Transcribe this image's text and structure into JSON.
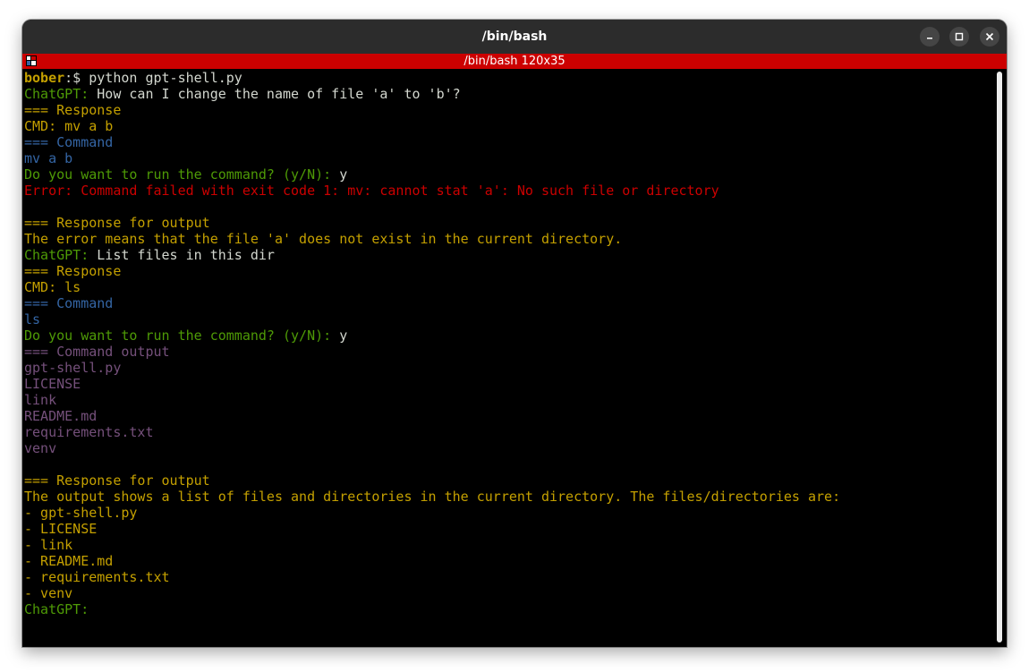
{
  "window": {
    "title": "/bin/bash",
    "tab_title": "/bin/bash 120x35",
    "controls": [
      "minimize-icon",
      "maximize-icon",
      "close-icon"
    ]
  },
  "colors": {
    "titlebar": "#2c2c2c",
    "tabbar": "#cc0000",
    "background": "#000000",
    "green": "#4e9a06",
    "yellow": "#c4a000",
    "blue": "#3465a4",
    "red": "#cc0000",
    "purple": "#75507b",
    "white": "#d3d7cf"
  },
  "terminal": {
    "lines": [
      [
        {
          "t": "bober",
          "c": "boldyellow"
        },
        {
          "t": ":$ python gpt-shell.py",
          "c": "white"
        }
      ],
      [
        {
          "t": "ChatGPT:",
          "c": "green"
        },
        {
          "t": " How can I change the name of file 'a' to 'b'?",
          "c": "white"
        }
      ],
      [
        {
          "t": "=== Response",
          "c": "yellow"
        }
      ],
      [
        {
          "t": "CMD: mv a b",
          "c": "yellow"
        }
      ],
      [
        {
          "t": "=== Command",
          "c": "blue"
        }
      ],
      [
        {
          "t": "mv a b",
          "c": "blue"
        }
      ],
      [
        {
          "t": "Do you want to run the command? (y/N):",
          "c": "green"
        },
        {
          "t": " y",
          "c": "white"
        }
      ],
      [
        {
          "t": "Error: Command failed with exit code 1: mv: cannot stat 'a': No such file or directory",
          "c": "red"
        }
      ],
      [],
      [
        {
          "t": "=== Response for output",
          "c": "yellow"
        }
      ],
      [
        {
          "t": "The error means that the file 'a' does not exist in the current directory.",
          "c": "yellow"
        }
      ],
      [
        {
          "t": "ChatGPT:",
          "c": "green"
        },
        {
          "t": " List files in this dir",
          "c": "white"
        }
      ],
      [
        {
          "t": "=== Response",
          "c": "yellow"
        }
      ],
      [
        {
          "t": "CMD: ls",
          "c": "yellow"
        }
      ],
      [
        {
          "t": "=== Command",
          "c": "blue"
        }
      ],
      [
        {
          "t": "ls",
          "c": "blue"
        }
      ],
      [
        {
          "t": "Do you want to run the command? (y/N):",
          "c": "green"
        },
        {
          "t": " y",
          "c": "white"
        }
      ],
      [
        {
          "t": "=== Command output",
          "c": "purple"
        }
      ],
      [
        {
          "t": "gpt-shell.py",
          "c": "purple"
        }
      ],
      [
        {
          "t": "LICENSE",
          "c": "purple"
        }
      ],
      [
        {
          "t": "link",
          "c": "purple"
        }
      ],
      [
        {
          "t": "README.md",
          "c": "purple"
        }
      ],
      [
        {
          "t": "requirements.txt",
          "c": "purple"
        }
      ],
      [
        {
          "t": "venv",
          "c": "purple"
        }
      ],
      [],
      [
        {
          "t": "=== Response for output",
          "c": "yellow"
        }
      ],
      [
        {
          "t": "The output shows a list of files and directories in the current directory. The files/directories are:",
          "c": "yellow"
        }
      ],
      [
        {
          "t": "- gpt-shell.py",
          "c": "yellow"
        }
      ],
      [
        {
          "t": "- LICENSE",
          "c": "yellow"
        }
      ],
      [
        {
          "t": "- link",
          "c": "yellow"
        }
      ],
      [
        {
          "t": "- README.md",
          "c": "yellow"
        }
      ],
      [
        {
          "t": "- requirements.txt",
          "c": "yellow"
        }
      ],
      [
        {
          "t": "- venv",
          "c": "yellow"
        }
      ],
      [
        {
          "t": "ChatGPT:",
          "c": "green"
        }
      ]
    ]
  }
}
